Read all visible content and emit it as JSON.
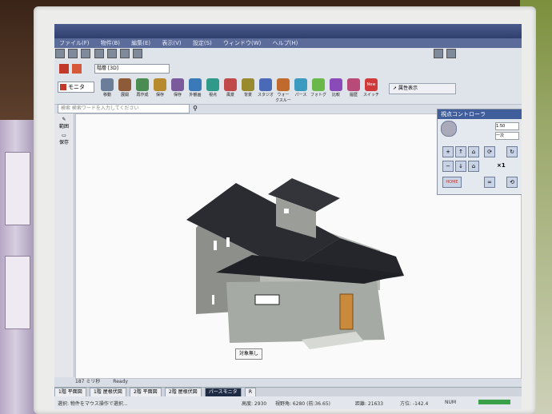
{
  "menu": {
    "items": [
      "ファイル(F)",
      "物件(B)",
      "編集(E)",
      "表示(V)",
      "設定(S)",
      "ウィンドウ(W)",
      "ヘルプ(H)"
    ]
  },
  "toolbar_mode": {
    "dropdown": "モニタ",
    "combo_value": "階層 [3D]"
  },
  "toolbar_buttons": [
    {
      "label": "移動",
      "icon": "move-icon"
    },
    {
      "label": "展開",
      "icon": "expand-icon"
    },
    {
      "label": "再作成",
      "icon": "refresh-icon"
    },
    {
      "label": "保存",
      "icon": "save-icon"
    },
    {
      "label": "保存",
      "icon": "save-alt-icon"
    },
    {
      "label": "外観画",
      "icon": "exterior-icon"
    },
    {
      "label": "視点",
      "icon": "eye-icon"
    },
    {
      "label": "風景",
      "icon": "landscape-icon"
    },
    {
      "label": "背景",
      "icon": "background-icon"
    },
    {
      "label": "スタジオ",
      "icon": "studio-icon"
    },
    {
      "label": "ウォークスルー",
      "icon": "walk-icon"
    },
    {
      "label": "パース",
      "icon": "perspective-icon"
    },
    {
      "label": "フォトグ",
      "icon": "photo-icon"
    },
    {
      "label": "比較",
      "icon": "compare-icon"
    },
    {
      "label": "履歴",
      "icon": "history-icon"
    },
    {
      "label": "スイッチ",
      "icon": "switch-icon",
      "badge": "New"
    }
  ],
  "attribute_button": {
    "label": "属性表示"
  },
  "search": {
    "placeholder": "検索 検索ワードを入力してください"
  },
  "left_strip": {
    "labels": [
      "範囲",
      "保存"
    ]
  },
  "view_controller": {
    "title": "視点コントローラ",
    "values": [
      "1:50",
      "一次"
    ],
    "multiplier": "×1",
    "home_label": "HOME"
  },
  "tooltip": {
    "text": "対象無し"
  },
  "status": {
    "timing": "187 ミリ秒",
    "state": "Ready"
  },
  "tabs": {
    "items": [
      "1階 平面図",
      "1階 屋根伏図",
      "2階 平面図",
      "2階 屋根伏図",
      "パースモニタ",
      "R"
    ],
    "active_index": 4
  },
  "statusbar": {
    "hint": "選択: 物件をマウス操作で選択...",
    "fields": [
      "高度: 2930",
      "視野角: 6280 (前:36.65)",
      "距離: 21633",
      "方位: -142.4",
      "NUM"
    ]
  },
  "colors": {
    "menubar": "#5b6c9a",
    "accent": "#3f5e9b",
    "house_wall": "#a6aaa4",
    "roof": "#2a2c31",
    "door": "#c98a3b"
  }
}
